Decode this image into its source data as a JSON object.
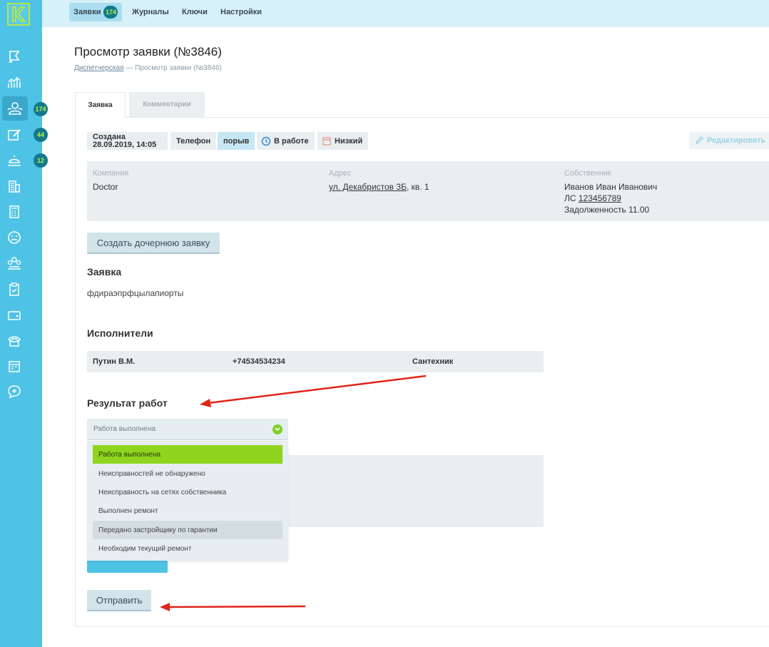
{
  "nav": {
    "items": [
      {
        "label": "Заявки",
        "badge": "174",
        "active": true
      },
      {
        "label": "Журналы"
      },
      {
        "label": "Ключи"
      },
      {
        "label": "Настройки"
      }
    ]
  },
  "sidebar": {
    "logo_letter": "K",
    "badges": {
      "requests": "174",
      "journals": "44",
      "keys": "12"
    },
    "icons": [
      "flag-icon",
      "chart-icon",
      "users-icon",
      "edit-icon",
      "bell-icon",
      "building-icon",
      "calculator-icon",
      "sad-face-icon",
      "group-icon",
      "clipboard-icon",
      "wallet-icon",
      "phone-icon",
      "calendar-icon",
      "chat-plus-icon"
    ]
  },
  "page": {
    "title": "Просмотр заявки (№3846)",
    "breadcrumb_link": "Диспетчерская",
    "breadcrumb_sep": " — ",
    "breadcrumb_current": "Просмотр заявки (№3846)"
  },
  "tabs": {
    "request": "Заявка",
    "comments": "Комментарии"
  },
  "tags": {
    "created_label": "Создана",
    "created_date": "28.09.2019, 14:05",
    "source": "Телефон",
    "category": "порыв",
    "status": "В работе",
    "priority": "Низкий"
  },
  "edit_label": "Редактировать",
  "info": {
    "company_label": "Компания",
    "company": "Doctor",
    "address_label": "Адрес",
    "address_street": "ул. Декабристов 3Б",
    "address_apt": ", кв. 1",
    "owner_label": "Собственник",
    "owner_name": "Иванов Иван Иванович",
    "account_prefix": "ЛС ",
    "account": "123456789",
    "debt": "Задолженность 11.00"
  },
  "child_request_label": "Создать дочернюю заявку",
  "request_section": {
    "title": "Заявка",
    "text": "фдираэпрфцылапиорты"
  },
  "executors": {
    "title": "Исполнители",
    "rows": [
      {
        "name": "Путин В.М.",
        "phone": "+74534534234",
        "role": "Сантехник"
      }
    ]
  },
  "result": {
    "title": "Результат работ",
    "selected": "Работа выполнена",
    "options": [
      "Работа выполнена",
      "Неисправностей не обнаружено",
      "Неисправность на сетях собственника",
      "Выполнен ремонт",
      "Передано застройщику по гарантии",
      "Необходим текущий ремонт"
    ]
  },
  "submit_label": "Отправить",
  "colors": {
    "sidebar": "#4fc3e6",
    "accent_green": "#8fd41e",
    "badge": "#127a8a",
    "arrow": "#e0241b"
  }
}
